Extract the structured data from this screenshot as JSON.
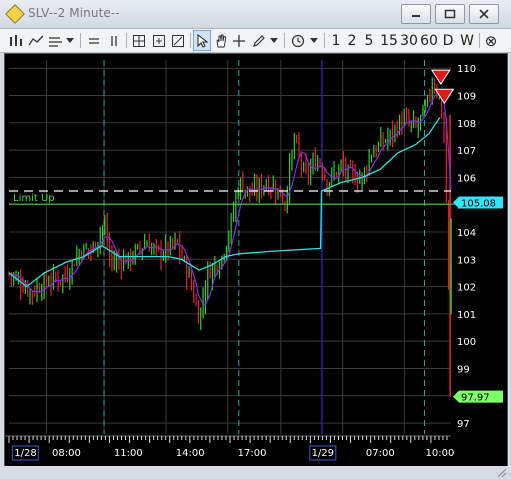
{
  "window": {
    "title": "SLV--2 Minute--",
    "controls": [
      "minimize",
      "maximize",
      "close"
    ]
  },
  "toolbar": {
    "icons": [
      "line-draw-icon",
      "area-icon",
      "fib-icon",
      "dropdown-arrow-icon",
      "horizontal-lines-icon",
      "vertical-lines-icon",
      "grid-add-icon",
      "grid-remove-icon",
      "expand-icon",
      "pointer-icon",
      "hand-icon",
      "crosshair-icon",
      "pencil-icon",
      "dropdown-arrow-icon",
      "clock-icon",
      "dropdown-arrow-icon"
    ],
    "timeframes": [
      "1",
      "2",
      "5",
      "15",
      "30",
      "60",
      "D",
      "W"
    ],
    "close_label": "⊗"
  },
  "chart_data": {
    "type": "candlestick",
    "symbol": "SLV",
    "interval": "2 Minute",
    "y_ticks": [
      110,
      109,
      108,
      107,
      106,
      105,
      104,
      103,
      102,
      101,
      100,
      99,
      98,
      97
    ],
    "x_ticks": [
      "1/28",
      "08:00",
      "11:00",
      "14:00",
      "17:00",
      "1/29",
      "07:00",
      "10:00"
    ],
    "limit_line": {
      "label": "Limit Up",
      "price": 105.5
    },
    "markers": [
      {
        "label": "105.08",
        "price": 105.08,
        "color": "#2ee6ff"
      },
      {
        "label": "97.97",
        "price": 97.97,
        "color": "#7dff6a"
      }
    ],
    "sell_arrows": [
      {
        "time_index": 0.977,
        "price": 109.6
      },
      {
        "time_index": 0.985,
        "price": 108.9
      }
    ],
    "grid": true,
    "colors": {
      "background": "#000000",
      "up": "#33cc33",
      "down": "#e0262a",
      "moving_average": "#8a2be2",
      "vwap": "#30e0e0",
      "limit_line": "#49d949",
      "dashed_level": "#ffffff"
    }
  }
}
